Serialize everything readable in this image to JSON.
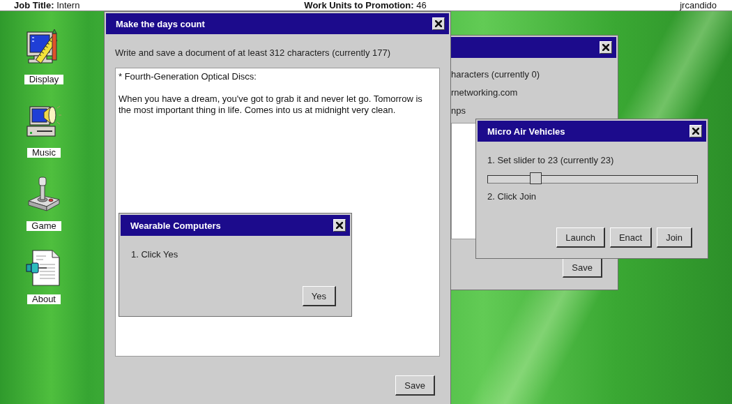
{
  "top_bar": {
    "job_title": "**Job Title:** Intern",
    "promotion": "**Work Units to Promotion:** 46",
    "username": "jrcandido"
  },
  "desktop_icons": [
    {
      "label": "Display",
      "kind": "display"
    },
    {
      "label": "Music",
      "kind": "music"
    },
    {
      "label": "Game",
      "kind": "game"
    },
    {
      "label": "About",
      "kind": "about"
    }
  ],
  "windows": [
    {
      "parts": [
        {
          "kind": "text",
          "text": "haracters (currently 0)"
        },
        {
          "kind": "text",
          "text": "rnetworking.com"
        },
        {
          "kind": "text",
          "text": "nps"
        },
        {
          "kind": "text_area"
        }
      ],
      "buttons": [
        "Save"
      ]
    },
    {
      "title": "Make the days count",
      "parts": [
        {
          "kind": "text",
          "text": "Write and save a document of at least 312 characters (currently 177)"
        },
        {
          "kind": "text_area",
          "value": "* Fourth-Generation Optical Discs:\n\nWhen you have a dream, you've got to grab it and never let go. Tomorrow is the most important thing in life. Comes into us at midnight very clean."
        }
      ],
      "buttons": [
        "Save"
      ]
    },
    {
      "title": "Wearable Computers",
      "parts": [
        {
          "kind": "text",
          "text": "1. Click Yes"
        }
      ],
      "buttons": [
        "Yes"
      ]
    },
    {
      "title": "Micro Air Vehicles",
      "parts": [
        {
          "kind": "text",
          "text": "1. Set slider to 23 (currently 23)"
        },
        {
          "kind": "slider",
          "level": 0.23
        },
        {
          "kind": "text",
          "text": "2. Click Join"
        }
      ],
      "buttons": [
        "Launch",
        "Enact",
        "Join"
      ]
    }
  ]
}
